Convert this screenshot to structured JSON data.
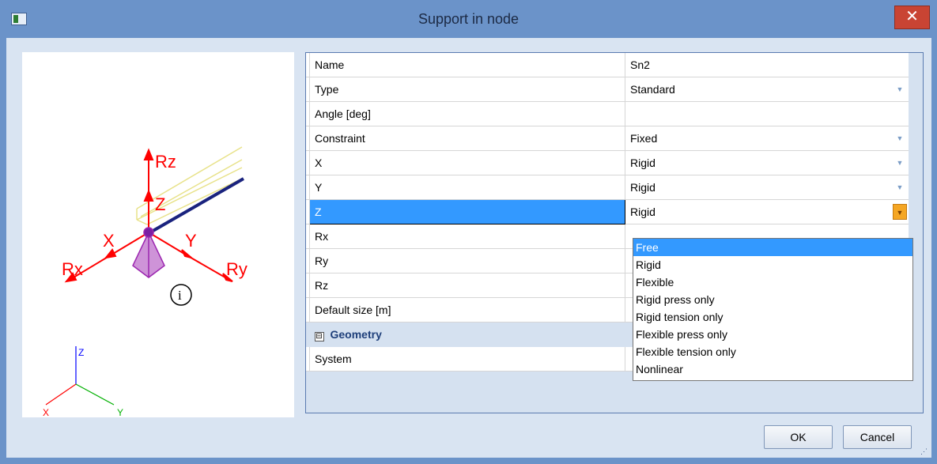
{
  "window": {
    "title": "Support in node",
    "close_label": "✕"
  },
  "preview": {
    "labels": {
      "rz": "Rz",
      "z": "Z",
      "x": "X",
      "y": "Y",
      "rx": "Rx",
      "ry": "Ry",
      "info": "i",
      "axis_z": "Z",
      "axis_x": "X",
      "axis_y": "Y"
    }
  },
  "properties": {
    "rows": [
      {
        "name": "Name",
        "value": "Sn2"
      },
      {
        "name": "Type",
        "value": "Standard"
      },
      {
        "name": "Angle [deg]",
        "value": ""
      },
      {
        "name": "Constraint",
        "value": "Fixed"
      },
      {
        "name": "X",
        "value": "Rigid"
      },
      {
        "name": "Y",
        "value": "Rigid"
      },
      {
        "name": "Z",
        "value": "Rigid"
      },
      {
        "name": "Rx",
        "value": ""
      },
      {
        "name": "Ry",
        "value": ""
      },
      {
        "name": "Rz",
        "value": ""
      },
      {
        "name": "Default size [m]",
        "value": ""
      }
    ],
    "group": {
      "expander": "⊟",
      "title": "Geometry"
    },
    "system_row": {
      "name": "System",
      "value": ""
    }
  },
  "dropdown": {
    "options": [
      "Free",
      "Rigid",
      "Flexible",
      "Rigid press only",
      "Rigid tension only",
      "Flexible press only",
      "Flexible tension only",
      "Nonlinear"
    ],
    "highlighted": "Free"
  },
  "buttons": {
    "ok": "OK",
    "cancel": "Cancel"
  },
  "colors": {
    "selection": "#3399ff",
    "titlebar": "#6b93c9",
    "close": "#c94433"
  }
}
